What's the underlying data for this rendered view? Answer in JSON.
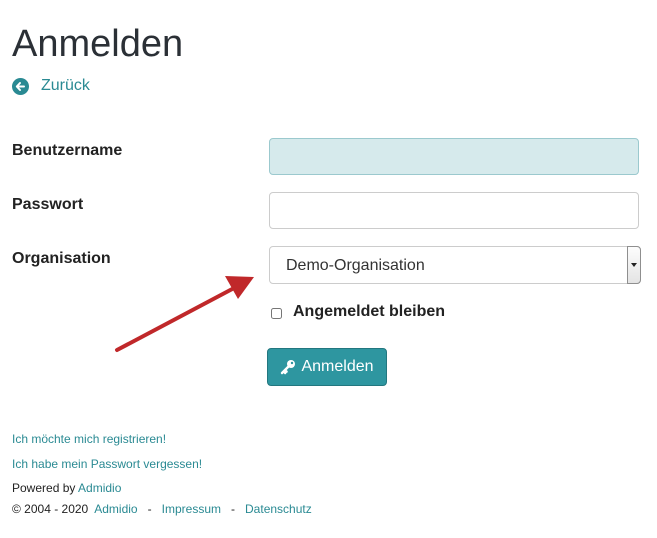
{
  "page": {
    "title": "Anmelden"
  },
  "nav": {
    "back_label": "Zurück"
  },
  "form": {
    "username_label": "Benutzername",
    "username_value": "",
    "password_label": "Passwort",
    "password_value": "",
    "organization_label": "Organisation",
    "organization_selected": "Demo-Organisation",
    "remember_label": "Angemeldet bleiben",
    "remember_checked": false,
    "submit_label": "Anmelden"
  },
  "footer": {
    "register_link": "Ich möchte mich registrieren!",
    "forgot_password_link": "Ich habe mein Passwort vergessen!",
    "powered_by_text": "Powered by",
    "powered_by_link": "Admidio",
    "copyright_text": "© 2004 - 2020",
    "copyright_link": "Admidio",
    "separator": "-",
    "imprint_link": "Impressum",
    "privacy_link": "Datenschutz"
  },
  "annotation": {
    "arrow_color": "#c0282a"
  },
  "colors": {
    "accent": "#2e96a0",
    "link": "#2a8a93",
    "focused_input_bg": "#d6eaec",
    "heading": "#2b3036"
  },
  "icons": {
    "back": "arrow-circle-left-icon",
    "submit": "key-icon",
    "select": "chevron-down-icon"
  }
}
